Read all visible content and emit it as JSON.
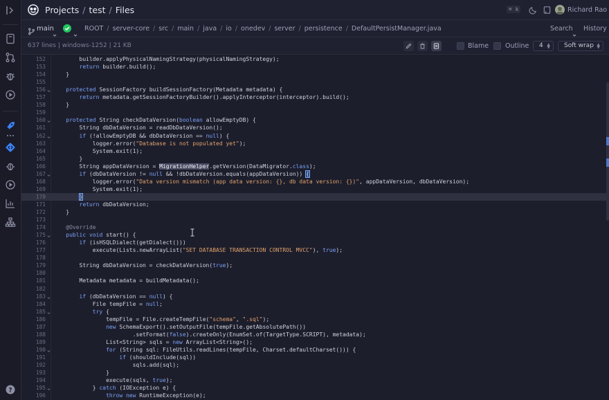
{
  "header": {
    "breadcrumbs": [
      "Projects",
      "test",
      "Files"
    ],
    "kbd_hint": "⌘ k",
    "user_name": "Richard Rao"
  },
  "pathbar": {
    "branch": "main",
    "path": [
      "ROOT",
      "server-core",
      "src",
      "main",
      "java",
      "io",
      "onedev",
      "server",
      "persistence"
    ],
    "file": "DefaultPersistManager.java",
    "search_label": "Search",
    "history_label": "History"
  },
  "infobar": {
    "info": "637 lines | windows-1252 | 21 KB",
    "blame_label": "Blame",
    "outline_label": "Outline",
    "tab_size": "4",
    "wrap_mode": "Soft wrap"
  },
  "code": {
    "lines": [
      {
        "n": "152",
        "fold": false,
        "t": [
          [
            "        builder.applyPhysicalNamingStrategy(physicalNamingStrategy);",
            ""
          ]
        ]
      },
      {
        "n": "153",
        "fold": false,
        "t": [
          [
            "        ",
            ""
          ],
          [
            "return",
            "kw"
          ],
          [
            " builder.build();",
            ""
          ]
        ]
      },
      {
        "n": "154",
        "fold": false,
        "t": [
          [
            "    }",
            ""
          ]
        ]
      },
      {
        "n": "155",
        "fold": false,
        "t": [
          [
            "",
            ""
          ]
        ]
      },
      {
        "n": "156",
        "fold": true,
        "t": [
          [
            "    ",
            ""
          ],
          [
            "protected",
            "kw"
          ],
          [
            " SessionFactory buildSessionFactory(Metadata metadata) {",
            ""
          ]
        ]
      },
      {
        "n": "157",
        "fold": false,
        "t": [
          [
            "        ",
            ""
          ],
          [
            "return",
            "kw"
          ],
          [
            " metadata.getSessionFactoryBuilder().applyInterceptor(interceptor).build();",
            ""
          ]
        ]
      },
      {
        "n": "158",
        "fold": false,
        "t": [
          [
            "    }",
            ""
          ]
        ]
      },
      {
        "n": "159",
        "fold": false,
        "t": [
          [
            "",
            ""
          ]
        ]
      },
      {
        "n": "160",
        "fold": true,
        "t": [
          [
            "    ",
            ""
          ],
          [
            "protected",
            "kw"
          ],
          [
            " String checkDataVersion(",
            ""
          ],
          [
            "boolean",
            "kw"
          ],
          [
            " allowEmptyDB) {",
            ""
          ]
        ]
      },
      {
        "n": "161",
        "fold": false,
        "t": [
          [
            "        String dbDataVersion = readDbDataVersion();",
            ""
          ]
        ]
      },
      {
        "n": "162",
        "fold": true,
        "t": [
          [
            "        ",
            ""
          ],
          [
            "if",
            "kw"
          ],
          [
            " (!allowEmptyDB && dbDataVersion == ",
            ""
          ],
          [
            "null",
            "kw"
          ],
          [
            ") {",
            ""
          ]
        ]
      },
      {
        "n": "163",
        "fold": false,
        "t": [
          [
            "            logger.error(",
            ""
          ],
          [
            "\"Database is not populated yet\"",
            "str"
          ],
          [
            ");",
            ""
          ]
        ]
      },
      {
        "n": "164",
        "fold": false,
        "t": [
          [
            "            System.exit(1);",
            ""
          ]
        ]
      },
      {
        "n": "165",
        "fold": false,
        "t": [
          [
            "        }",
            ""
          ]
        ]
      },
      {
        "n": "166",
        "fold": false,
        "t": [
          [
            "        String appDataVersion = ",
            ""
          ],
          [
            "MigrationHelper",
            "sel"
          ],
          [
            ".getVersion(DataMigrator.",
            ""
          ],
          [
            "class",
            "kw"
          ],
          [
            ");",
            ""
          ]
        ]
      },
      {
        "n": "167",
        "fold": true,
        "t": [
          [
            "        ",
            ""
          ],
          [
            "if",
            "kw"
          ],
          [
            " (dbDataVersion != ",
            ""
          ],
          [
            "null",
            "kw"
          ],
          [
            " && !dbDataVersion.equals(appDataVersion)) ",
            ""
          ],
          [
            "{",
            "brace"
          ]
        ]
      },
      {
        "n": "168",
        "fold": false,
        "t": [
          [
            "            logger.error(",
            ""
          ],
          [
            "\"Data version mismatch (app data version: {}, db data version: {})\"",
            "str"
          ],
          [
            ", appDataVersion, dbDataVersion);",
            ""
          ]
        ]
      },
      {
        "n": "169",
        "fold": false,
        "t": [
          [
            "            System.exit(1);",
            ""
          ]
        ]
      },
      {
        "n": "170",
        "fold": false,
        "hl": true,
        "t": [
          [
            "        ",
            ""
          ],
          [
            "}",
            "brace"
          ]
        ]
      },
      {
        "n": "171",
        "fold": false,
        "t": [
          [
            "        ",
            ""
          ],
          [
            "return",
            "kw"
          ],
          [
            " dbDataVersion;",
            ""
          ]
        ]
      },
      {
        "n": "172",
        "fold": false,
        "t": [
          [
            "    }",
            ""
          ]
        ]
      },
      {
        "n": "173",
        "fold": false,
        "t": [
          [
            "",
            ""
          ]
        ]
      },
      {
        "n": "174",
        "fold": false,
        "t": [
          [
            "    ",
            ""
          ],
          [
            "@Override",
            "ann"
          ]
        ]
      },
      {
        "n": "175",
        "fold": true,
        "t": [
          [
            "    ",
            ""
          ],
          [
            "public",
            "kw"
          ],
          [
            " ",
            ""
          ],
          [
            "void",
            "kw"
          ],
          [
            " start() {",
            ""
          ]
        ]
      },
      {
        "n": "176",
        "fold": false,
        "t": [
          [
            "        ",
            ""
          ],
          [
            "if",
            "kw"
          ],
          [
            " (isHSQLDialect(getDialect()))",
            ""
          ]
        ]
      },
      {
        "n": "177",
        "fold": false,
        "t": [
          [
            "            execute(Lists.newArrayList(",
            ""
          ],
          [
            "\"SET DATABASE TRANSACTION CONTROL MVCC\"",
            "str"
          ],
          [
            "), ",
            ""
          ],
          [
            "true",
            "kw"
          ],
          [
            ");",
            ""
          ]
        ]
      },
      {
        "n": "178",
        "fold": false,
        "t": [
          [
            "",
            ""
          ]
        ]
      },
      {
        "n": "179",
        "fold": false,
        "t": [
          [
            "        String dbDataVersion = checkDataVersion(",
            ""
          ],
          [
            "true",
            "kw"
          ],
          [
            ");",
            ""
          ]
        ]
      },
      {
        "n": "180",
        "fold": false,
        "t": [
          [
            "",
            ""
          ]
        ]
      },
      {
        "n": "181",
        "fold": false,
        "t": [
          [
            "        Metadata metadata = buildMetadata();",
            ""
          ]
        ]
      },
      {
        "n": "182",
        "fold": false,
        "t": [
          [
            "",
            ""
          ]
        ]
      },
      {
        "n": "183",
        "fold": true,
        "t": [
          [
            "        ",
            ""
          ],
          [
            "if",
            "kw"
          ],
          [
            " (dbDataVersion == ",
            ""
          ],
          [
            "null",
            "kw"
          ],
          [
            ") {",
            ""
          ]
        ]
      },
      {
        "n": "184",
        "fold": false,
        "t": [
          [
            "            File tempFile = ",
            ""
          ],
          [
            "null",
            "kw"
          ],
          [
            ";",
            ""
          ]
        ]
      },
      {
        "n": "185",
        "fold": true,
        "t": [
          [
            "            ",
            ""
          ],
          [
            "try",
            "kw"
          ],
          [
            " {",
            ""
          ]
        ]
      },
      {
        "n": "186",
        "fold": false,
        "t": [
          [
            "                tempFile = File.createTempFile(",
            ""
          ],
          [
            "\"schema\"",
            "str"
          ],
          [
            ", ",
            ""
          ],
          [
            "\".sql\"",
            "str"
          ],
          [
            ");",
            ""
          ]
        ]
      },
      {
        "n": "187",
        "fold": false,
        "t": [
          [
            "                ",
            ""
          ],
          [
            "new",
            "kw"
          ],
          [
            " SchemaExport().setOutputFile(tempFile.getAbsolutePath())",
            ""
          ]
        ]
      },
      {
        "n": "188",
        "fold": false,
        "t": [
          [
            "                        .setFormat(",
            ""
          ],
          [
            "false",
            "kw"
          ],
          [
            ").createOnly(EnumSet.of(TargetType.SCRIPT), metadata);",
            ""
          ]
        ]
      },
      {
        "n": "189",
        "fold": false,
        "t": [
          [
            "                List<String> sqls = ",
            ""
          ],
          [
            "new",
            "kw"
          ],
          [
            " ArrayList<String>();",
            ""
          ]
        ]
      },
      {
        "n": "190",
        "fold": true,
        "t": [
          [
            "                ",
            ""
          ],
          [
            "for",
            "kw"
          ],
          [
            " (String sql: FileUtils.readLines(tempFile, Charset.defaultCharset())) {",
            ""
          ]
        ]
      },
      {
        "n": "191",
        "fold": false,
        "t": [
          [
            "                    ",
            ""
          ],
          [
            "if",
            "kw"
          ],
          [
            " (shouldInclude(sql))",
            ""
          ]
        ]
      },
      {
        "n": "192",
        "fold": false,
        "t": [
          [
            "                        sqls.add(sql);",
            ""
          ]
        ]
      },
      {
        "n": "193",
        "fold": false,
        "t": [
          [
            "                }",
            ""
          ]
        ]
      },
      {
        "n": "194",
        "fold": false,
        "t": [
          [
            "                execute(sqls, ",
            ""
          ],
          [
            "true",
            "kw"
          ],
          [
            ");",
            ""
          ]
        ]
      },
      {
        "n": "195",
        "fold": true,
        "t": [
          [
            "            } ",
            ""
          ],
          [
            "catch",
            "kw"
          ],
          [
            " (IOException e) {",
            ""
          ]
        ]
      },
      {
        "n": "196",
        "fold": false,
        "t": [
          [
            "                ",
            ""
          ],
          [
            "throw",
            "kw"
          ],
          [
            " ",
            ""
          ],
          [
            "new",
            "kw"
          ],
          [
            " RuntimeException(e);",
            ""
          ]
        ]
      }
    ]
  },
  "colors": {
    "accent": "#3b82f6",
    "success": "#22c55e",
    "keyword": "#7aa2f7",
    "string": "#e0a36b"
  },
  "icons": {
    "sidebar": [
      "sidebar-toggle-icon",
      "files-icon",
      "pull-requests-icon",
      "issues-icon",
      "builds-icon",
      "rocket-icon",
      "code-icon",
      "bug-icon",
      "play-icon",
      "chart-icon",
      "hierarchy-icon",
      "help-icon"
    ],
    "header": [
      "onedev-logo-icon",
      "moon-icon",
      "bookmark-icon"
    ]
  }
}
